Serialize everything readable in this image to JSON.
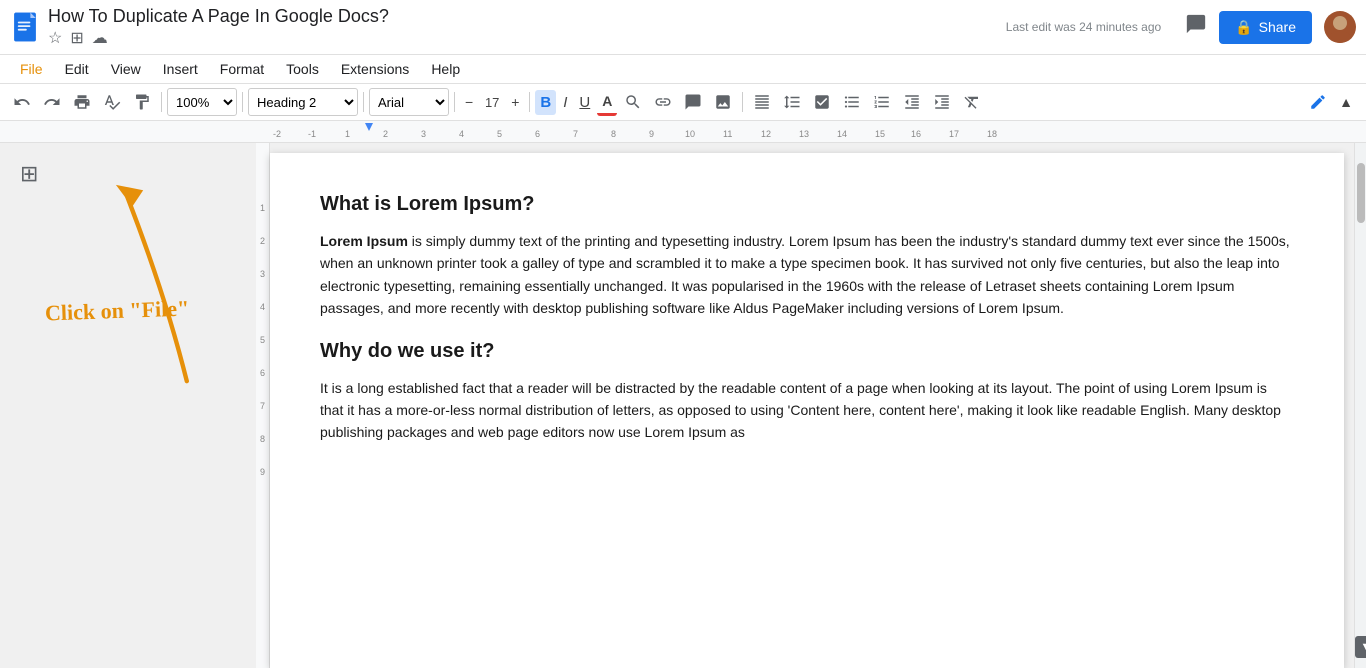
{
  "title_bar": {
    "doc_title": "How To Duplicate A Page In Google Docs?",
    "last_edit": "Last edit was 24 minutes ago",
    "share_label": "Share",
    "lock_icon": "🔒"
  },
  "menu": {
    "items": [
      "File",
      "Edit",
      "View",
      "Insert",
      "Format",
      "Tools",
      "Extensions",
      "Help"
    ]
  },
  "toolbar": {
    "zoom": "100%",
    "style": "Heading 2",
    "font": "Arial",
    "font_size": "17",
    "undo_label": "↩",
    "redo_label": "↪"
  },
  "annotation": {
    "text": "Click on \"File\"",
    "arrow_color": "#e6900a"
  },
  "document": {
    "heading1": "What is Lorem Ipsum?",
    "para1_bold": "Lorem Ipsum",
    "para1_rest": " is simply dummy text of the printing and typesetting industry. Lorem Ipsum has been the industry's standard dummy text ever since the 1500s, when an unknown printer took a galley of type and scrambled it to make a type specimen book. It has survived not only five centuries, but also the leap into electronic typesetting, remaining essentially unchanged. It was popularised in the 1960s with the release of Letraset sheets containing Lorem Ipsum passages, and more recently with desktop publishing software like Aldus PageMaker including versions of Lorem Ipsum.",
    "heading2": "Why do we use it?",
    "para2": "It is a long established fact that a reader will be distracted by the readable content of a page when looking at its layout. The point of using Lorem Ipsum is that it has a more-or-less normal distribution of letters, as opposed to using 'Content here, content here', making it look like readable English. Many desktop publishing packages and web page editors now use Lorem Ipsum as"
  },
  "ruler": {
    "marks": [
      "-2",
      "-1",
      "1",
      "2",
      "3",
      "4",
      "5",
      "6",
      "7",
      "8",
      "9",
      "10",
      "11",
      "12",
      "13",
      "14",
      "15",
      "16",
      "17",
      "18"
    ]
  }
}
